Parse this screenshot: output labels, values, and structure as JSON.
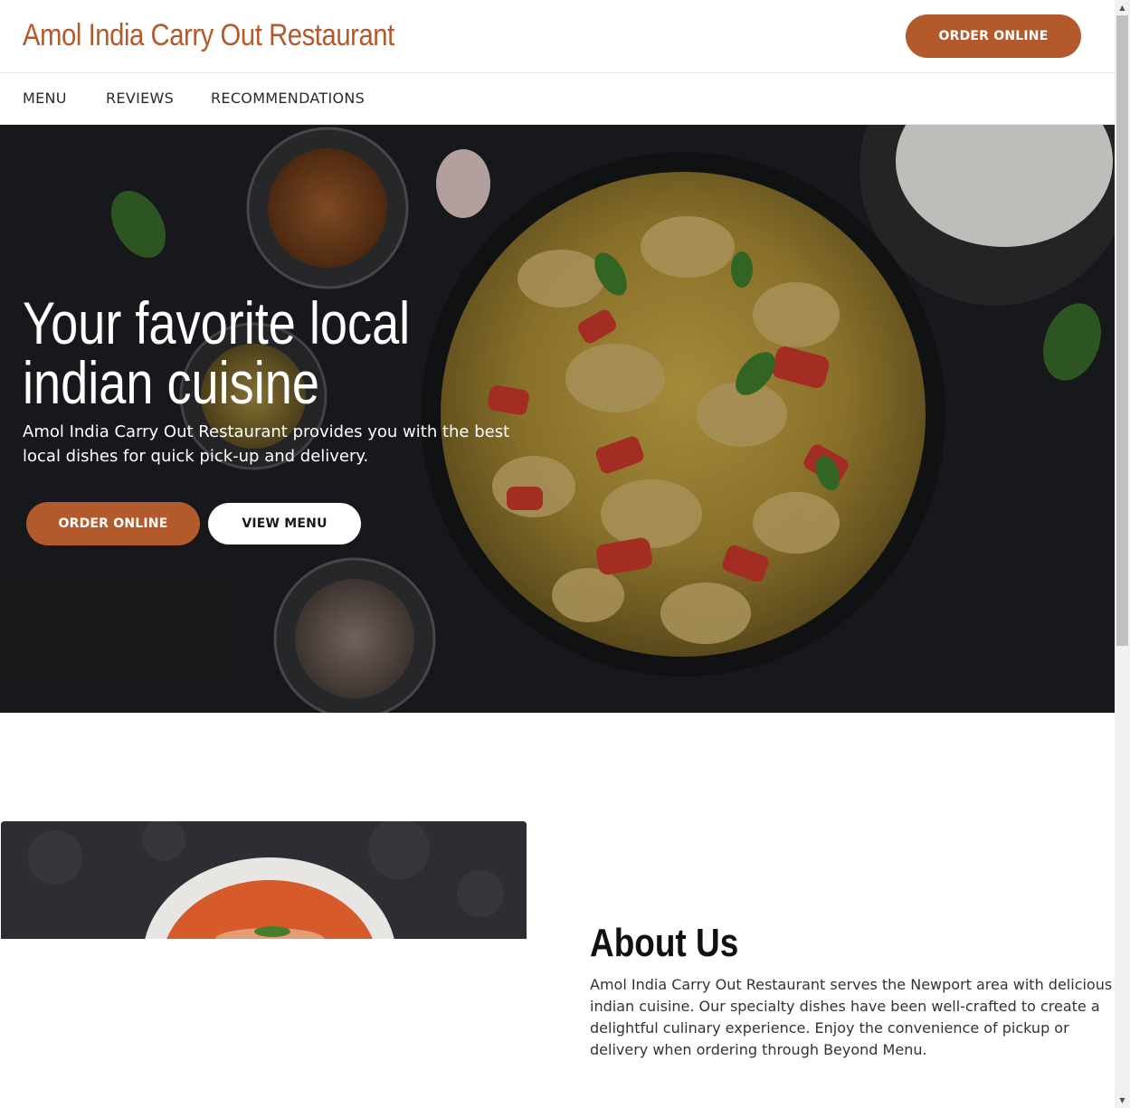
{
  "header": {
    "brand": "Amol India Carry Out Restaurant",
    "order_button": "ORDER ONLINE"
  },
  "nav": {
    "items": [
      {
        "label": "MENU"
      },
      {
        "label": "REVIEWS"
      },
      {
        "label": "RECOMMENDATIONS"
      }
    ]
  },
  "hero": {
    "title": "Your favorite local indian cuisine",
    "subtitle": "Amol India Carry Out Restaurant provides you with the best local dishes for quick pick-up and delivery.",
    "order_button": "ORDER ONLINE",
    "menu_button": "VIEW MENU"
  },
  "about": {
    "title": "About Us",
    "text": "Amol India Carry Out Restaurant serves the Newport area with delicious indian cuisine. Our specialty dishes have been well-crafted to create a delightful culinary experience. Enjoy the convenience of pickup or delivery when ordering through Beyond Menu."
  },
  "colors": {
    "accent": "#b35a2c",
    "hero_text": "#ffffff",
    "body_text": "#333333"
  },
  "icons": {
    "scroll_up": "scroll-up-arrow-icon",
    "scroll_down": "scroll-down-arrow-icon"
  }
}
